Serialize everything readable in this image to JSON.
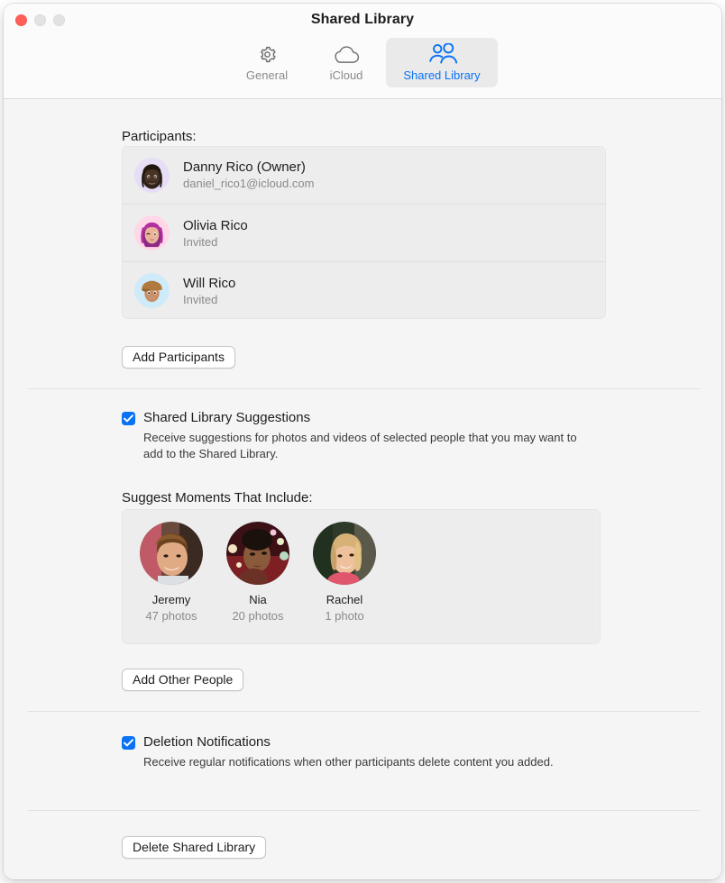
{
  "window": {
    "title": "Shared Library",
    "traffic_lights": [
      "close",
      "minimize",
      "zoom"
    ]
  },
  "toolbar": {
    "tabs": [
      {
        "label": "General",
        "icon": "gear-icon",
        "selected": false
      },
      {
        "label": "iCloud",
        "icon": "cloud-icon",
        "selected": false
      },
      {
        "label": "Shared Library",
        "icon": "two-people-icon",
        "selected": true
      }
    ],
    "accent_color": "#0a72f5",
    "selected_tab_bg": "#eaeaea"
  },
  "participants": {
    "heading": "Participants:",
    "rows": [
      {
        "name": "Danny Rico (Owner)",
        "sub": "daniel_rico1@icloud.com",
        "avatar": "memoji-danny"
      },
      {
        "name": "Olivia Rico",
        "sub": "Invited",
        "avatar": "memoji-olivia"
      },
      {
        "name": "Will Rico",
        "sub": "Invited",
        "avatar": "memoji-will"
      }
    ],
    "add_button": "Add Participants"
  },
  "suggestions": {
    "checkbox_label": "Shared Library Suggestions",
    "checkbox_checked": true,
    "description": "Receive suggestions for photos and videos of selected people that you may want to add to the Shared Library.",
    "moments_heading": "Suggest Moments That Include:",
    "people": [
      {
        "name": "Jeremy",
        "count": "47 photos"
      },
      {
        "name": "Nia",
        "count": "20 photos"
      },
      {
        "name": "Rachel",
        "count": "1 photo"
      }
    ],
    "add_button": "Add Other People"
  },
  "deletion": {
    "checkbox_label": "Deletion Notifications",
    "checkbox_checked": true,
    "description": "Receive regular notifications when other participants delete content you added."
  },
  "footer": {
    "delete_button": "Delete Shared Library"
  }
}
